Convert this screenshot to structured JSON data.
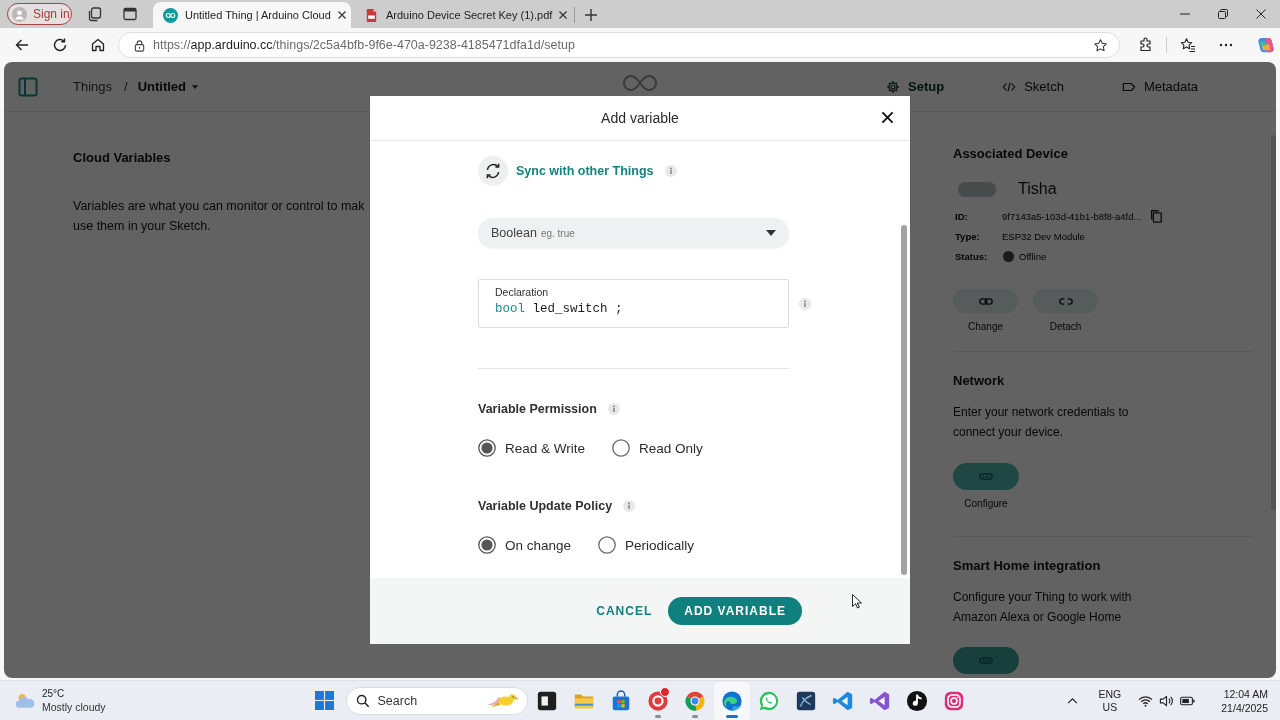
{
  "browser": {
    "profile": {
      "label": "Sign in"
    },
    "tabs": [
      {
        "title": "Untitled Thing | Arduino Cloud",
        "kind": "web",
        "selected": true
      },
      {
        "title": "Arduino Device Secret Key (1).pdf",
        "kind": "pdf",
        "selected": false
      }
    ],
    "address": {
      "scheme": "https://",
      "host": "app.arduino.cc",
      "path": "/things/2c5a4bfb-9f6e-470a-9238-4185471dfa1d/setup"
    }
  },
  "page": {
    "breadcrumb": {
      "parent": "Things",
      "separator": "/",
      "current": "Untitled"
    },
    "tabs": [
      {
        "label": "Setup",
        "kind": "setup",
        "selected": true
      },
      {
        "label": "Sketch",
        "kind": "sketch",
        "selected": false
      },
      {
        "label": "Metadata",
        "kind": "metadata",
        "selected": false
      }
    ]
  },
  "cloud_variables": {
    "title": "Cloud Variables",
    "description_lines": [
      "Variables are what you can monitor or control to mak",
      "use them in your Sketch."
    ]
  },
  "associated_device": {
    "title": "Associated Device",
    "name": "Tisha",
    "id": {
      "label": "ID:",
      "value": "9f7143a5-103d-41b1-b8f8-a4fd..."
    },
    "type": {
      "label": "Type:",
      "value": "ESP32 Dev Module"
    },
    "status": {
      "label": "Status:",
      "value": "Offline",
      "online": false
    },
    "actions": [
      {
        "label": "Change",
        "kind": "change"
      },
      {
        "label": "Detach",
        "kind": "detach"
      }
    ]
  },
  "network": {
    "title": "Network",
    "description": "Enter your network credentials to connect your device.",
    "action": {
      "label": "Configure"
    }
  },
  "smart_home": {
    "title": "Smart Home integration",
    "description": "Configure your Thing to work with Amazon Alexa or Google Home"
  },
  "modal": {
    "title": "Add variable",
    "sync": {
      "label": "Sync with other Things"
    },
    "type_select": {
      "value": "Boolean",
      "hint": "eg. true"
    },
    "declaration": {
      "label": "Declaration",
      "keyword": "bool",
      "identifier": "led_switch ;"
    },
    "permission": {
      "title": "Variable Permission",
      "options": [
        {
          "label": "Read & Write",
          "selected": true
        },
        {
          "label": "Read Only",
          "selected": false
        }
      ]
    },
    "update_policy": {
      "title": "Variable Update Policy",
      "options": [
        {
          "label": "On change",
          "selected": true
        },
        {
          "label": "Periodically",
          "selected": false
        }
      ]
    },
    "actions": [
      {
        "label": "CANCEL",
        "kind": "secondary"
      },
      {
        "label": "ADD VARIABLE",
        "kind": "primary"
      }
    ]
  },
  "taskbar": {
    "weather": {
      "temperature": "25°C",
      "condition": "Mostly cloudy"
    },
    "search": {
      "placeholder": "Search"
    },
    "apps": [
      {
        "kind": "task-view",
        "running": false,
        "selected": false,
        "notification": false
      },
      {
        "kind": "folder",
        "running": false,
        "selected": false,
        "notification": false
      },
      {
        "kind": "store",
        "running": false,
        "selected": false,
        "notification": false
      },
      {
        "kind": "ring",
        "running": true,
        "selected": false,
        "notification": true
      },
      {
        "kind": "segmented",
        "running": true,
        "selected": false,
        "notification": false
      },
      {
        "kind": "wave",
        "running": true,
        "selected": true,
        "notification": false
      },
      {
        "kind": "chat",
        "running": false,
        "selected": false,
        "notification": false
      },
      {
        "kind": "tile",
        "running": false,
        "selected": false,
        "notification": false
      },
      {
        "kind": "code",
        "running": false,
        "selected": false,
        "notification": false
      },
      {
        "kind": "ribbon",
        "running": false,
        "selected": false,
        "notification": false
      },
      {
        "kind": "note",
        "running": false,
        "selected": false,
        "notification": false
      },
      {
        "kind": "camera",
        "running": false,
        "selected": false,
        "notification": false
      }
    ],
    "tray": {
      "language": "ENG",
      "region": "US",
      "time": "12:04 AM",
      "date": "21/4/2025"
    }
  }
}
